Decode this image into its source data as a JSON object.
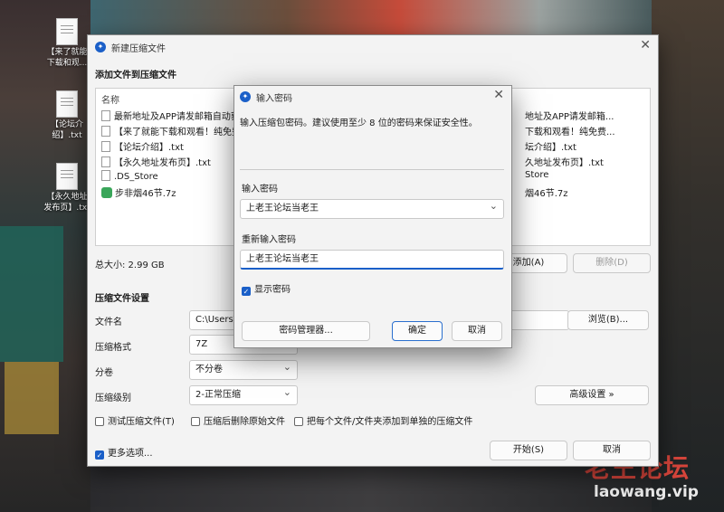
{
  "desktop": {
    "icons": [
      {
        "label": "【来了就能\n下载和观..."
      },
      {
        "label": "【论坛介\n绍】.txt"
      },
      {
        "label": "【永久地址\n发布页】.txt"
      }
    ],
    "watermark_cn": "老王论坛",
    "watermark_url": "laowang.vip"
  },
  "main_dialog": {
    "title": "新建压缩文件",
    "add_files_heading": "添加文件到压缩文件",
    "file_list": {
      "column_name": "名称",
      "items": [
        {
          "name": "最新地址及APP请发邮箱自动获",
          "right": "地址及APP请发邮箱..."
        },
        {
          "name": "【来了就能下载和观看！纯免费",
          "right": "下载和观看！纯免费..."
        },
        {
          "name": "【论坛介绍】.txt",
          "right": "坛介绍】.txt"
        },
        {
          "name": "【永久地址发布页】.txt",
          "right": "久地址发布页】.txt"
        },
        {
          "name": ".DS_Store",
          "right": "Store"
        },
        {
          "name": "步非烟46节.7z",
          "right": "烟46节.7z"
        }
      ]
    },
    "total_size": "总大小: 2.99 GB",
    "add_button": "添加(A)",
    "delete_button": "删除(D)",
    "settings_heading": "压缩文件设置",
    "filename_label": "文件名",
    "filename_value": "C:\\Users\\",
    "browse_button": "浏览(B)...",
    "format_label": "压缩格式",
    "format_value": "7Z",
    "split_label": "分卷",
    "split_value": "不分卷",
    "level_label": "压缩级别",
    "level_value": "2-正常压缩",
    "advanced_button": "高级设置 »",
    "test_archive": "测试压缩文件(T)",
    "delete_after": "压缩后删除原始文件",
    "each_separate": "把每个文件/文件夹添加到单独的压缩文件",
    "more_options": "更多选项...",
    "start_button": "开始(S)",
    "cancel_button": "取消"
  },
  "password_dialog": {
    "title": "输入密码",
    "info": "输入压缩包密码。建议使用至少 8 位的密码来保证安全性。",
    "password_label": "输入密码",
    "password_value": "上老王论坛当老王",
    "confirm_label": "重新输入密码",
    "confirm_value": "上老王论坛当老王",
    "show_password": "显示密码",
    "manager_button": "密码管理器...",
    "ok_button": "确定",
    "cancel_button": "取消"
  },
  "colors": {
    "accent": "#1a5fc8",
    "watermark_red": "#d6453b"
  }
}
